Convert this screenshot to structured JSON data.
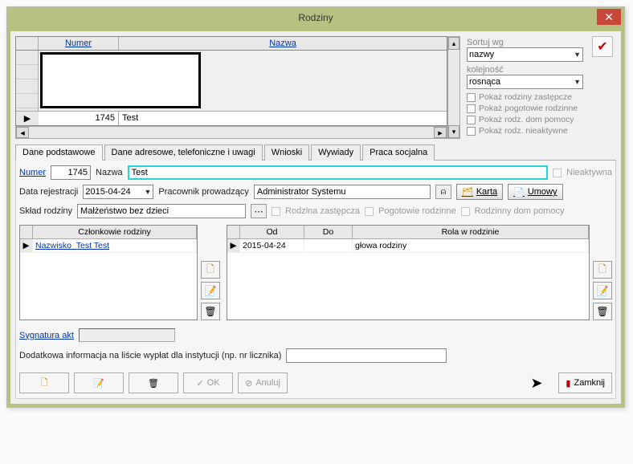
{
  "window": {
    "title": "Rodziny"
  },
  "grid": {
    "col_numer": "Numer",
    "col_nazwa": "Nazwa",
    "row_numer": "1745",
    "row_nazwa": "Test"
  },
  "sort": {
    "label": "Sortuj wg",
    "value": "nazwy",
    "order_label": "kolejność",
    "order_value": "rosnąca"
  },
  "filters": {
    "zastepcze": "Pokaż rodziny zastępcze",
    "pogotowie": "Pokaż pogotowie rodzinne",
    "dom_pomocy": "Pokaż rodz. dom pomocy",
    "nieaktywne": "Pokaż rodz. nieaktywne"
  },
  "tabs": {
    "t1": "Dane podstawowe",
    "t2": "Dane adresowe, telefoniczne i uwagi",
    "t3": "Wnioski",
    "t4": "Wywiady",
    "t5": "Praca socjalna"
  },
  "form": {
    "numer_label": "Numer",
    "numer_value": "1745",
    "nazwa_label": "Nazwa",
    "nazwa_value": "Test",
    "nieaktywna_label": "Nieaktywna",
    "data_rej_label": "Data rejestracji",
    "data_rej_value": "2015-04-24",
    "pracownik_label": "Pracownik prowadzący",
    "pracownik_value": "Administrator Systemu",
    "karta_btn": "Karta",
    "umowy_btn": "Umowy",
    "sklad_label": "Skład rodziny",
    "sklad_value": "Małżeństwo bez dzieci",
    "rodzina_zast": "Rodzina zastępcza",
    "pogotowie_rodz": "Pogotowie rodzinne",
    "rodz_dom": "Rodzinny dom pomocy"
  },
  "members": {
    "header": "Członkowie rodziny",
    "row1": "Nazwisko_Test Test"
  },
  "roles": {
    "col_od": "Od",
    "col_do": "Do",
    "col_rola": "Rola w rodzinie",
    "row_od": "2015-04-24",
    "row_do": "",
    "row_rola": "głowa rodziny"
  },
  "sygnatura": {
    "label": "Sygnatura akt"
  },
  "dodatkowa": {
    "label": "Dodatkowa informacja na liście wypłat dla instytucji (np. nr licznika)"
  },
  "bottom": {
    "ok": "OK",
    "anuluj": "Anuluj",
    "zamknij": "Zamknij"
  }
}
